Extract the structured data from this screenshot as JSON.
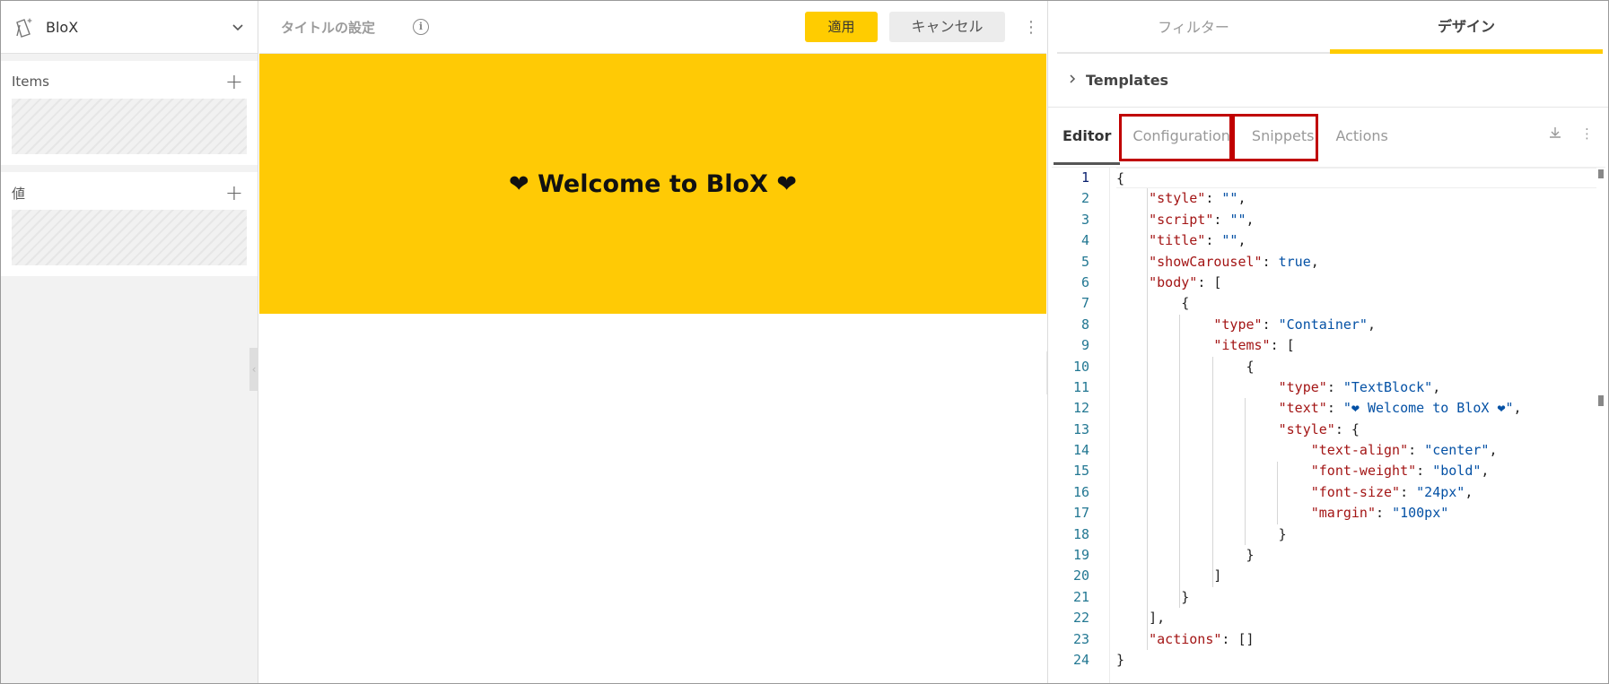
{
  "sidebar": {
    "title": "BloX",
    "sections": [
      {
        "label": "Items"
      },
      {
        "label": "値"
      }
    ]
  },
  "header": {
    "title_placeholder": "タイトルの設定",
    "apply_label": "適用",
    "cancel_label": "キャンセル"
  },
  "preview": {
    "text": "❤ Welcome to BloX ❤"
  },
  "right": {
    "top_tabs": [
      {
        "label": "フィルター",
        "active": false
      },
      {
        "label": "デザイン",
        "active": true
      }
    ],
    "templates_label": "Templates",
    "sub_tabs": [
      {
        "label": "Editor",
        "active": true
      },
      {
        "label": "Configuration",
        "active": false
      },
      {
        "label": "Snippets",
        "active": false
      },
      {
        "label": "Actions",
        "active": false
      }
    ]
  },
  "editor": {
    "line_numbers": [
      "1",
      "2",
      "3",
      "4",
      "5",
      "6",
      "7",
      "8",
      "9",
      "10",
      "11",
      "12",
      "13",
      "14",
      "15",
      "16",
      "17",
      "18",
      "19",
      "20",
      "21",
      "22",
      "23",
      "24"
    ],
    "lines": [
      "{",
      "    \"style\": \"\",",
      "    \"script\": \"\",",
      "    \"title\": \"\",",
      "    \"showCarousel\": true,",
      "    \"body\": [",
      "        {",
      "            \"type\": \"Container\",",
      "            \"items\": [",
      "                {",
      "                    \"type\": \"TextBlock\",",
      "                    \"text\": \"❤ Welcome to BloX ❤\",",
      "                    \"style\": {",
      "                        \"text-align\": \"center\",",
      "                        \"font-weight\": \"bold\",",
      "                        \"font-size\": \"24px\",",
      "                        \"margin\": \"100px\"",
      "                    }",
      "                }",
      "            ]",
      "        }",
      "    ],",
      "    \"actions\": []",
      "}"
    ]
  },
  "colors": {
    "accent": "#ffcc00",
    "highlight_box": "#c00000",
    "json_key": "#a31515",
    "json_string": "#0451a5"
  }
}
